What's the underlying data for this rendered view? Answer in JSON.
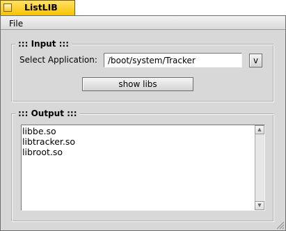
{
  "window": {
    "title": "ListLIB"
  },
  "menubar": {
    "items": [
      {
        "label": "File"
      }
    ]
  },
  "input_group": {
    "legend": "::: Input :::",
    "select_label": "Select Application:",
    "path_value": "/boot/system/Tracker",
    "browse_label": "v",
    "show_libs_label": "show libs"
  },
  "output_group": {
    "legend": "::: Output :::",
    "libraries": [
      "libbe.so",
      "libtracker.so",
      "libroot.so"
    ]
  },
  "scrollbar": {
    "up_glyph": "▲",
    "down_glyph": "▼"
  },
  "colors": {
    "tab_yellow": "#ffcb00",
    "window_gray": "#d8d8d8"
  }
}
